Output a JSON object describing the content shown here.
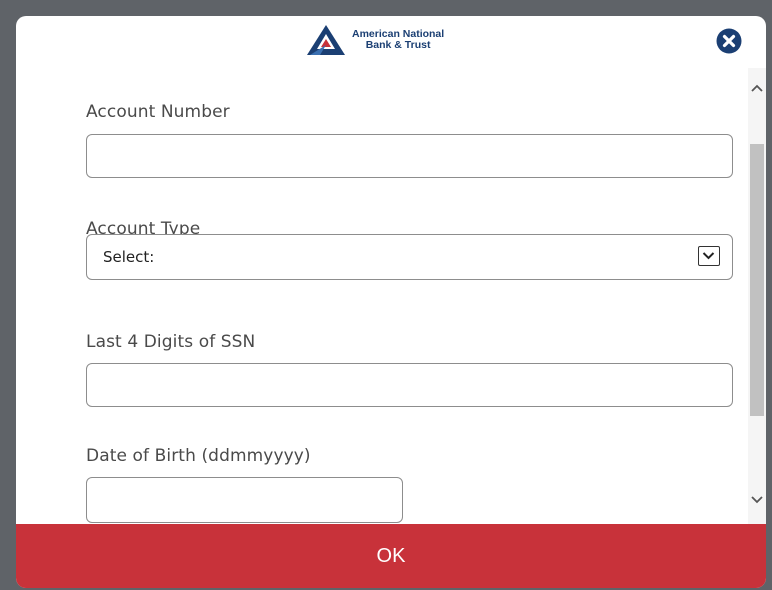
{
  "brand": {
    "name_line1": "American National",
    "name_line2": "Bank & Trust",
    "logo_icon": "triangle-a-logo-icon",
    "primary_color": "#1b3f73",
    "accent_color": "#c8323a"
  },
  "header": {
    "close_icon": "close-icon"
  },
  "form": {
    "account_number": {
      "label": "Account Number",
      "value": ""
    },
    "account_type": {
      "label": "Account Type",
      "selected": "Select:"
    },
    "ssn_last4": {
      "label": "Last 4 Digits of SSN",
      "value": ""
    },
    "dob": {
      "label": "Date of Birth (ddmmyyyy)",
      "value": ""
    }
  },
  "actions": {
    "ok_label": "OK"
  }
}
